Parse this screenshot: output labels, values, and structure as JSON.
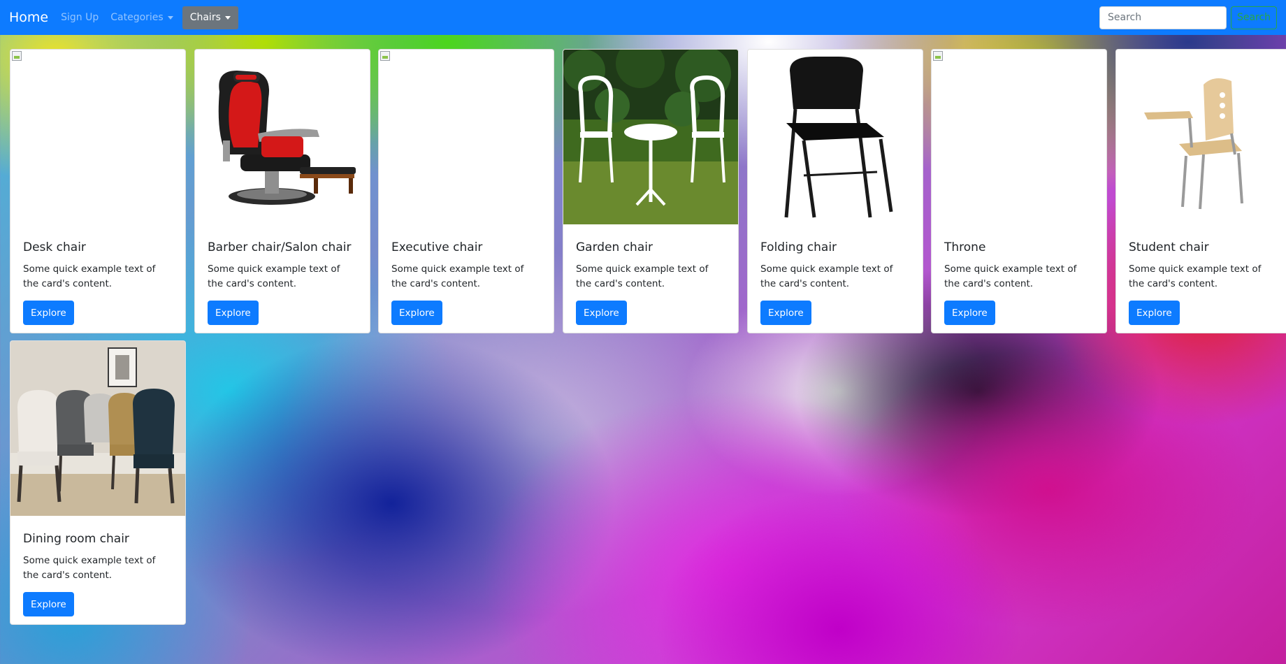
{
  "navbar": {
    "brand": "Home",
    "links": [
      "Sign Up",
      "Categories"
    ],
    "active": "Chairs",
    "search_placeholder": "Search",
    "search_button": "Search"
  },
  "cards": [
    {
      "title": "Desk chair",
      "text": "Some quick example text of the card's content.",
      "button": "Explore",
      "image": "broken"
    },
    {
      "title": "Barber chair/Salon chair",
      "text": "Some quick example text of the card's content.",
      "button": "Explore",
      "image": "barber-chair"
    },
    {
      "title": "Executive chair",
      "text": "Some quick example text of the card's content.",
      "button": "Explore",
      "image": "broken"
    },
    {
      "title": "Garden chair",
      "text": "Some quick example text of the card's content.",
      "button": "Explore",
      "image": "garden-chair"
    },
    {
      "title": "Folding chair",
      "text": "Some quick example text of the card's content.",
      "button": "Explore",
      "image": "folding-chair"
    },
    {
      "title": "Throne",
      "text": "Some quick example text of the card's content.",
      "button": "Explore",
      "image": "broken"
    },
    {
      "title": "Student chair",
      "text": "Some quick example text of the card's content.",
      "button": "Explore",
      "image": "student-chair"
    },
    {
      "title": "Dining room chair",
      "text": "Some quick example text of the card's content.",
      "button": "Explore",
      "image": "dining-chair"
    }
  ]
}
